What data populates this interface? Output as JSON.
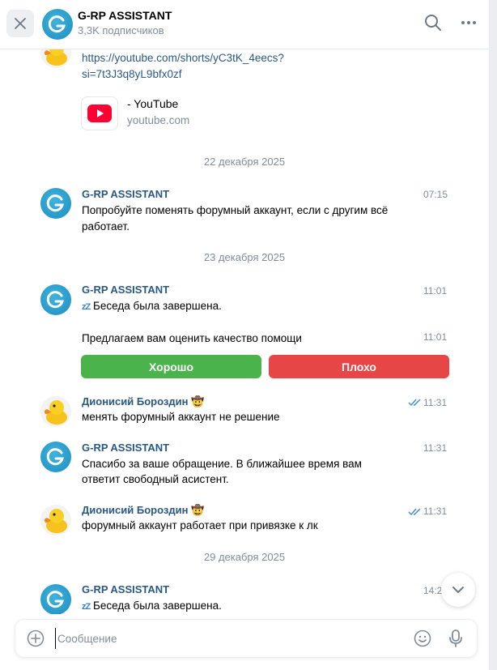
{
  "header": {
    "title": "G-RP ASSISTANT",
    "subtitle": "3,3K подписчиков"
  },
  "top_message": {
    "link_line1": "https://youtube.com/shorts/yC3tK_4eecs?",
    "link_line2": "si=7t3J3q8yL9bfx0zf",
    "preview_title": "- YouTube",
    "preview_domain": "youtube.com"
  },
  "dates": {
    "d1": "22 декабря 2025",
    "d2": "23 декабря 2025",
    "d3": "29 декабря 2025"
  },
  "messages": [
    {
      "author": "G-RP ASSISTANT",
      "time": "07:15",
      "line1": "Попробуйте поменять форумный аккаунт, если с другим всё",
      "line2": "работает."
    },
    {
      "author": "G-RP ASSISTANT",
      "time": "11:01",
      "text": "Беседа была завершена.",
      "zz": "zZ"
    },
    {
      "text": "Предлагаем вам оценить качество помощи",
      "time": "11:01"
    },
    {
      "author": "Дионисий Бороздин",
      "emoji": "🤠",
      "time": "11:31",
      "text": "менять форумный аккаунт не решение"
    },
    {
      "author": "G-RP ASSISTANT",
      "time": "11:31",
      "line1": "Спасибо за ваше обращение. В ближайшее время вам",
      "line2": "ответит свободный асистент."
    },
    {
      "author": "Дионисий Бороздин",
      "emoji": "🤠",
      "time": "11:31",
      "text": "форумный аккаунт работает при привязке к лк"
    },
    {
      "author": "G-RP ASSISTANT",
      "time": "14:2",
      "text": "Беседа была завершена.",
      "zz": "zZ"
    }
  ],
  "rating_buttons": {
    "good": "Хорошо",
    "bad": "Плохо"
  },
  "composer": {
    "placeholder": "Сообщение"
  },
  "colors": {
    "accent": "#2a5885",
    "good": "#4bb34b",
    "bad": "#e64646",
    "muted": "#818c99"
  }
}
